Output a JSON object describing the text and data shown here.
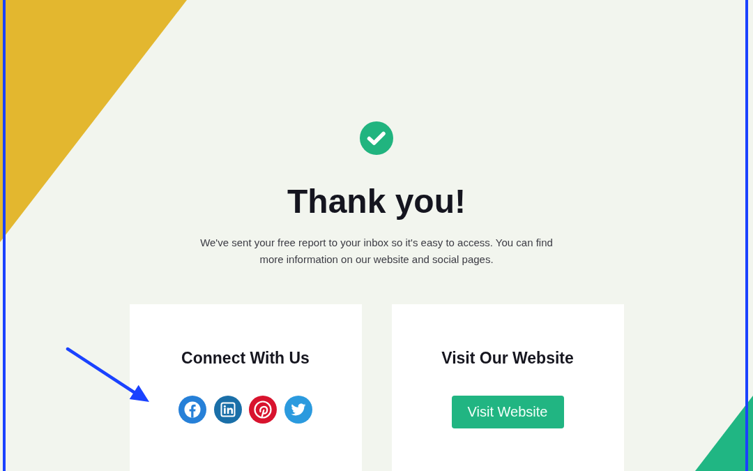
{
  "page": {
    "heading": "Thank you!",
    "message": "We've sent your free report to your inbox so it's easy to access. You can find more information on our website and social pages.",
    "cards": [
      {
        "kind": "social",
        "title": "Connect With Us"
      },
      {
        "kind": "link",
        "title": "Visit Our Website",
        "button": "Visit Website"
      }
    ]
  }
}
